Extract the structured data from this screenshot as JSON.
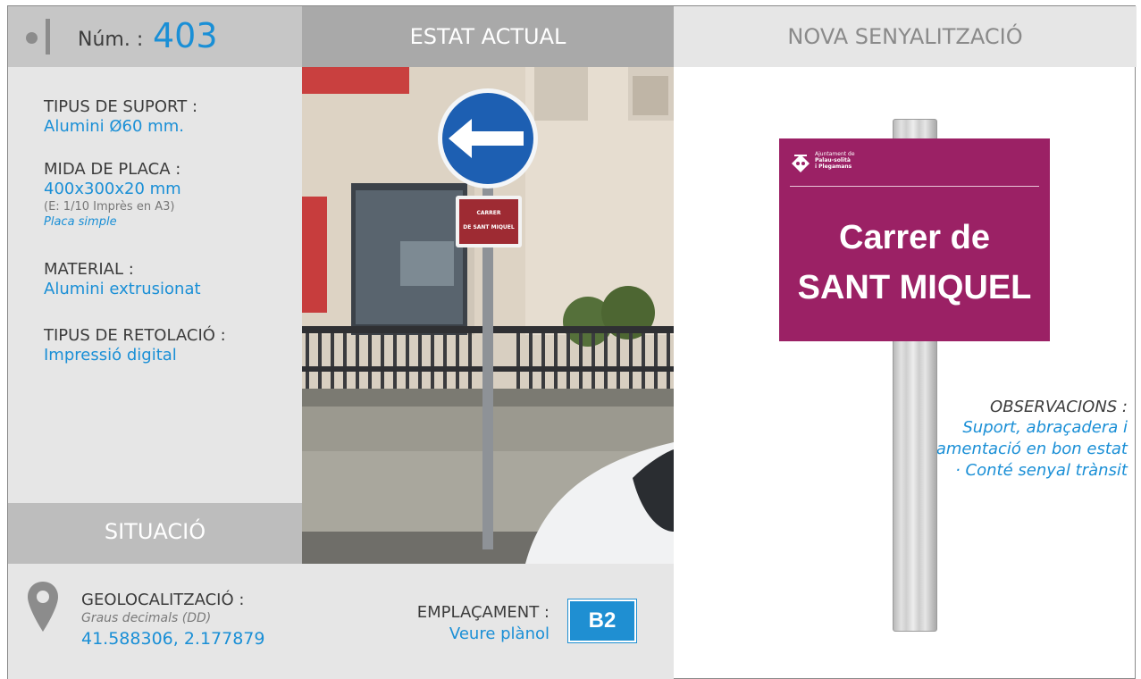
{
  "header": {
    "num_label": "Núm. :",
    "num_value": "403",
    "estat_actual": "ESTAT ACTUAL",
    "nova_senyalitzacio": "NOVA SENYALITZACIÓ"
  },
  "specs": {
    "tipus_suport_label": "TIPUS DE SUPORT :",
    "tipus_suport_value": "Alumini Ø60 mm.",
    "mida_placa_label": "MIDA DE PLACA :",
    "mida_placa_value": "400x300x20 mm",
    "mida_placa_scale": "(E: 1/10 Imprès en A3)",
    "mida_placa_type": "Placa simple",
    "material_label": "MATERIAL :",
    "material_value": "Alumini extrusionat",
    "retolacio_label": "TIPUS DE RETOLACIÓ :",
    "retolacio_value": "Impressió digital",
    "observacions_label": "OBSERVACIONS :",
    "observacions_lines": [
      "Suport, abraçadera i",
      "fonamentació en bon estat",
      "· Conté senyal trànsit"
    ]
  },
  "situacio": {
    "title": "SITUACIÓ",
    "geo_label": "GEOLOCALITZACIÓ :",
    "geo_sub": "Graus decimals (DD)",
    "geo_value": "41.588306, 2.177879",
    "emplacament_label": "EMPLAÇAMENT :",
    "emplacament_link": "Veure plànol",
    "emplacament_code": "B2"
  },
  "photo_sign": {
    "line1": "CARRER",
    "line2": "DE SANT MIQUEL"
  },
  "new_sign": {
    "org_line1": "Ajuntament de",
    "org_line2": "Palau-solità",
    "org_line3": "i Plegamans",
    "line1": "Carrer de",
    "line2": "SANT MIQUEL",
    "color": "#9b2165"
  },
  "colors": {
    "accent": "#1a8fd6",
    "badge": "#1f8fd2"
  }
}
